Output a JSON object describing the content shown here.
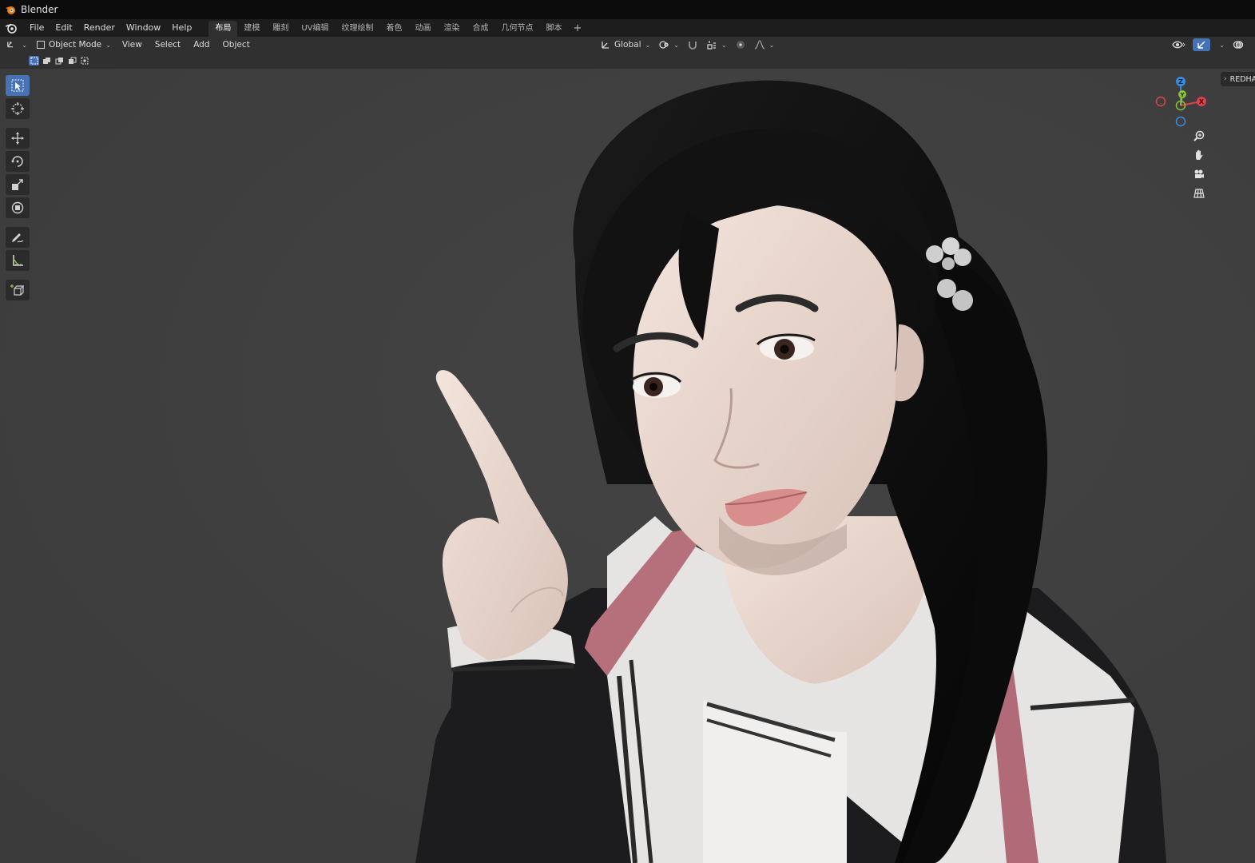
{
  "window": {
    "title": "Blender"
  },
  "menu": {
    "items": [
      "File",
      "Edit",
      "Render",
      "Window",
      "Help"
    ]
  },
  "workspaces": {
    "tabs": [
      "布局",
      "建模",
      "雕刻",
      "UV编辑",
      "纹理绘制",
      "着色",
      "动画",
      "渲染",
      "合成",
      "几何节点",
      "脚本"
    ],
    "active_index": 0,
    "add_label": "+"
  },
  "viewport_header": {
    "mode": "Object Mode",
    "menus": [
      "View",
      "Select",
      "Add",
      "Object"
    ],
    "transform_orientation": "Global"
  },
  "npanel": {
    "tab_label": "REDHA"
  },
  "gizmo": {
    "z_label": "Z",
    "x_label": "X",
    "y_label": "Y"
  },
  "colors": {
    "accent": "#4772b3",
    "axis_x": "#e0404c",
    "axis_y": "#8bc13a",
    "axis_z": "#3b8be0",
    "viewport_bg": "#3f3f3f"
  },
  "icons": {
    "toolbar": [
      "select-box-icon",
      "cursor-icon",
      "move-icon",
      "rotate-icon",
      "scale-icon",
      "transform-icon",
      "annotate-icon",
      "measure-icon",
      "add-cube-icon"
    ],
    "nav": [
      "zoom-icon",
      "pan-hand-icon",
      "camera-icon",
      "grid-ortho-icon"
    ]
  }
}
